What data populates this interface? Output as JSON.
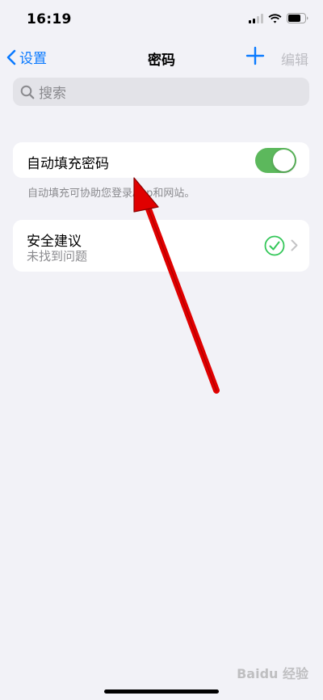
{
  "status": {
    "time": "16:19"
  },
  "nav": {
    "back_label": "设置",
    "title": "密码",
    "edit_label": "编辑"
  },
  "search": {
    "placeholder": "搜索"
  },
  "autofill": {
    "label": "自动填充密码",
    "enabled": true,
    "footnote": "自动填充可协助您登录App和网站。"
  },
  "security": {
    "title": "安全建议",
    "subtitle": "未找到问题"
  },
  "watermark": {
    "text": "Baidu 经验"
  },
  "colors": {
    "accent": "#0A7AFF",
    "toggle_on": "#5CB85C",
    "check": "#34C759",
    "annotation_arrow": "#E00000"
  }
}
